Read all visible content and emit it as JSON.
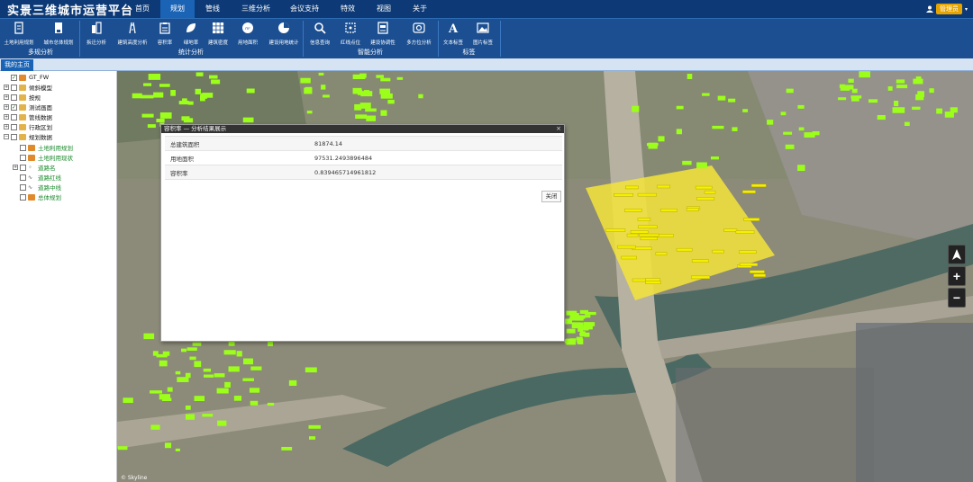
{
  "app": {
    "title": "实景三维城市运营平台"
  },
  "nav": {
    "tabs": [
      {
        "label": "首页"
      },
      {
        "label": "规划"
      },
      {
        "label": "管线"
      },
      {
        "label": "三维分析"
      },
      {
        "label": "会议支持"
      },
      {
        "label": "特效"
      },
      {
        "label": "视图"
      },
      {
        "label": "关于"
      }
    ],
    "active_index": 1
  },
  "user": {
    "name": "管理员"
  },
  "ribbon": {
    "groups": [
      {
        "label": "多规分析"
      },
      {
        "label": "统计分析"
      },
      {
        "label": "智能分析"
      },
      {
        "label": "标签"
      }
    ],
    "tools": [
      {
        "label": "土地利用规划",
        "icon": "document-icon"
      },
      {
        "label": "城市总体规划",
        "icon": "file-icon"
      },
      {
        "label": "拆迁分析",
        "icon": "building-icon"
      },
      {
        "label": "建筑高度分析",
        "icon": "road-icon"
      },
      {
        "label": "容积率",
        "icon": "clipboard-icon"
      },
      {
        "label": "绿地率",
        "icon": "leaf-icon"
      },
      {
        "label": "建筑密度",
        "icon": "grid-icon"
      },
      {
        "label": "用地面积",
        "icon": "area-icon"
      },
      {
        "label": "建设用地统计",
        "icon": "pie-chart-icon"
      },
      {
        "label": "信息查询",
        "icon": "search-icon"
      },
      {
        "label": "红线点位",
        "icon": "redline-icon"
      },
      {
        "label": "建设协调性",
        "icon": "report-icon"
      },
      {
        "label": "多方位分析",
        "icon": "target-icon"
      },
      {
        "label": "文本标签",
        "icon": "text-icon"
      },
      {
        "label": "图片标签",
        "icon": "image-icon"
      }
    ]
  },
  "home_tab": "我的主页",
  "tree": [
    {
      "label": "GT_FW",
      "depth": 0,
      "expander": "",
      "checked": true,
      "icon": "orange"
    },
    {
      "label": "倾斜模型",
      "depth": 0,
      "expander": "+",
      "checked": false,
      "icon": "folder"
    },
    {
      "label": "按规",
      "depth": 0,
      "expander": "+",
      "checked": false,
      "icon": "folder"
    },
    {
      "label": "测试画面",
      "depth": 0,
      "expander": "+",
      "checked": true,
      "icon": "folder"
    },
    {
      "label": "管线数据",
      "depth": 0,
      "expander": "+",
      "checked": false,
      "icon": "folder"
    },
    {
      "label": "行政区划",
      "depth": 0,
      "expander": "+",
      "checked": false,
      "icon": "folder"
    },
    {
      "label": "规划数据",
      "depth": 0,
      "expander": "−",
      "checked": false,
      "icon": "folder"
    },
    {
      "label": "土地利用规划",
      "depth": 1,
      "expander": "",
      "checked": false,
      "icon": "orange",
      "green": true
    },
    {
      "label": "土地利用现状",
      "depth": 1,
      "expander": "",
      "checked": false,
      "icon": "orange",
      "green": true
    },
    {
      "label": "道路名",
      "depth": 1,
      "expander": "+",
      "checked": false,
      "icon": "dots",
      "green": true
    },
    {
      "label": "道路红线",
      "depth": 1,
      "expander": "",
      "checked": false,
      "icon": "line",
      "green": true
    },
    {
      "label": "道路中线",
      "depth": 1,
      "expander": "",
      "checked": false,
      "icon": "line",
      "green": true
    },
    {
      "label": "总体规划",
      "depth": 1,
      "expander": "",
      "checked": false,
      "icon": "orange",
      "green": true
    }
  ],
  "dialog": {
    "title": "容积率 — 分析结果展示",
    "rows": [
      {
        "label": "总建筑面积",
        "value": "81874.14"
      },
      {
        "label": "用地面积",
        "value": "97531.2493896484"
      },
      {
        "label": "容积率",
        "value": "0.839465714961812"
      }
    ],
    "close_label": "关闭"
  },
  "map_controls": {
    "zoom_in": "+",
    "zoom_out": "−"
  },
  "attribution": "© Skyline",
  "colors": {
    "topbar": "#0d3a76",
    "ribbon": "#1b4f92",
    "active_tab": "#1a63b5",
    "building_highlight": "#9cff1a",
    "selection": "#ffea00"
  }
}
